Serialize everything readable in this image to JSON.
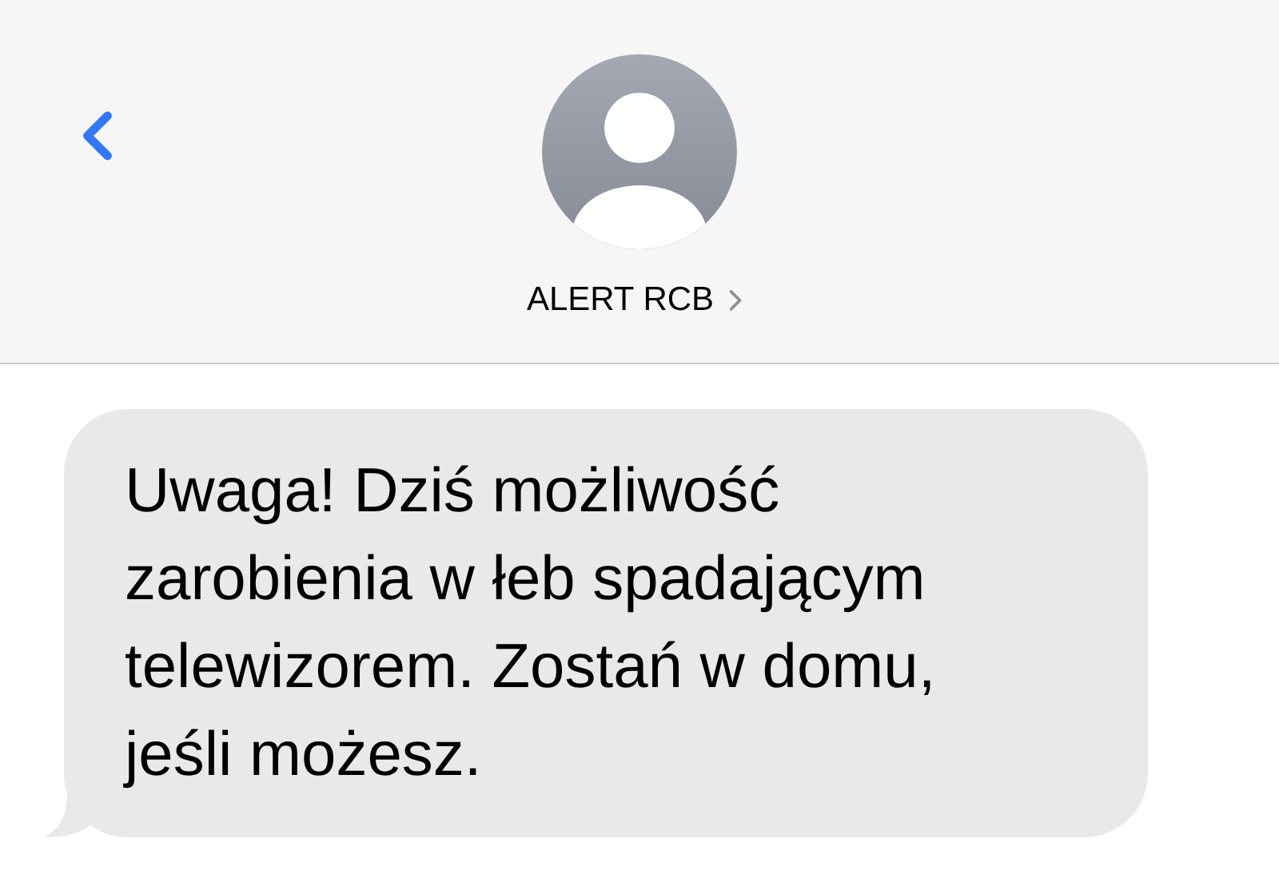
{
  "contact": {
    "name": "ALERT RCB"
  },
  "messages": [
    {
      "text": "Uwaga! Dziś możliwość zarobienia w łeb spadającym telewizorem. Zostań w domu, jeśli możesz.",
      "kind": "received"
    }
  ]
}
